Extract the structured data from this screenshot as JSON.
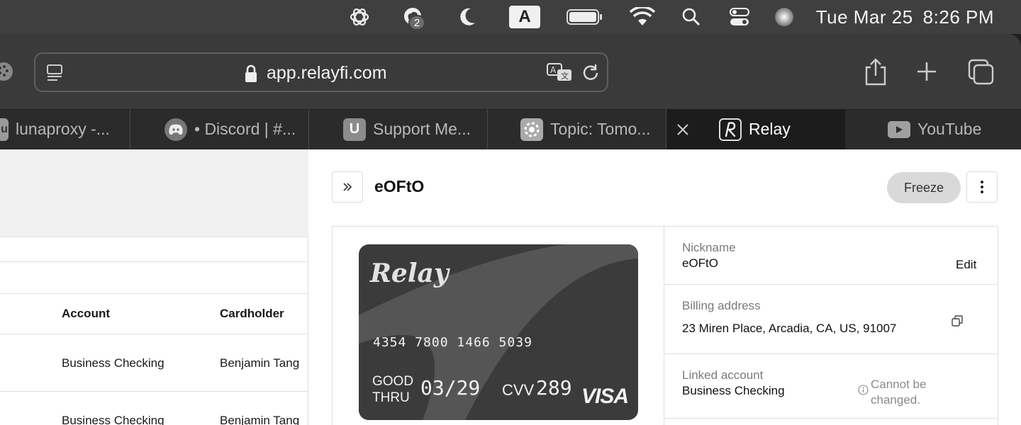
{
  "menubar": {
    "notification_count": "2",
    "input_source": "A",
    "clock": {
      "date": "Tue Mar 25",
      "time": "8:26 PM"
    }
  },
  "browser": {
    "url": "app.relayfi.com",
    "tabs": [
      {
        "label": "lunaproxy -...",
        "favicon": "u"
      },
      {
        "label": "• Discord | #...",
        "favicon": "discord-icon"
      },
      {
        "label": "Support Me...",
        "favicon": "U"
      },
      {
        "label": "Topic: Tomo...",
        "favicon": "gear-badge-icon"
      },
      {
        "label": "Relay",
        "favicon": "relay-icon",
        "active": true
      },
      {
        "label": "YouTube",
        "favicon": "youtube-icon"
      }
    ]
  },
  "cards_table": {
    "columns": [
      "Account",
      "Cardholder"
    ],
    "rows": [
      {
        "account": "Business Checking",
        "cardholder": "Benjamin Tang"
      },
      {
        "account": "Business Checking",
        "cardholder": "Benjamin Tang"
      }
    ]
  },
  "card_detail": {
    "title": "eOFtO",
    "freeze_label": "Freeze",
    "card": {
      "brand_logo": "Relay",
      "number": "4354 7800 1466 5039",
      "good_thru_label_1": "GOOD",
      "good_thru_label_2": "THRU",
      "expiry": "03/29",
      "cvv_label": "CVV",
      "cvv": "289",
      "network": "VISA"
    },
    "fields": {
      "nickname_label": "Nickname",
      "nickname_value": "eOFtO",
      "nickname_edit": "Edit",
      "billing_label": "Billing address",
      "billing_value": "23 Miren Place, Arcadia, CA, US, 91007",
      "linked_label": "Linked account",
      "linked_value": "Business Checking",
      "linked_note_1": "Cannot be",
      "linked_note_2": "changed."
    }
  },
  "colors": {
    "menubar": "#3f3f3f",
    "toolbar": "#3a3a3a",
    "tabbar": "#2b2b2b",
    "card": "#3b3b3b"
  }
}
